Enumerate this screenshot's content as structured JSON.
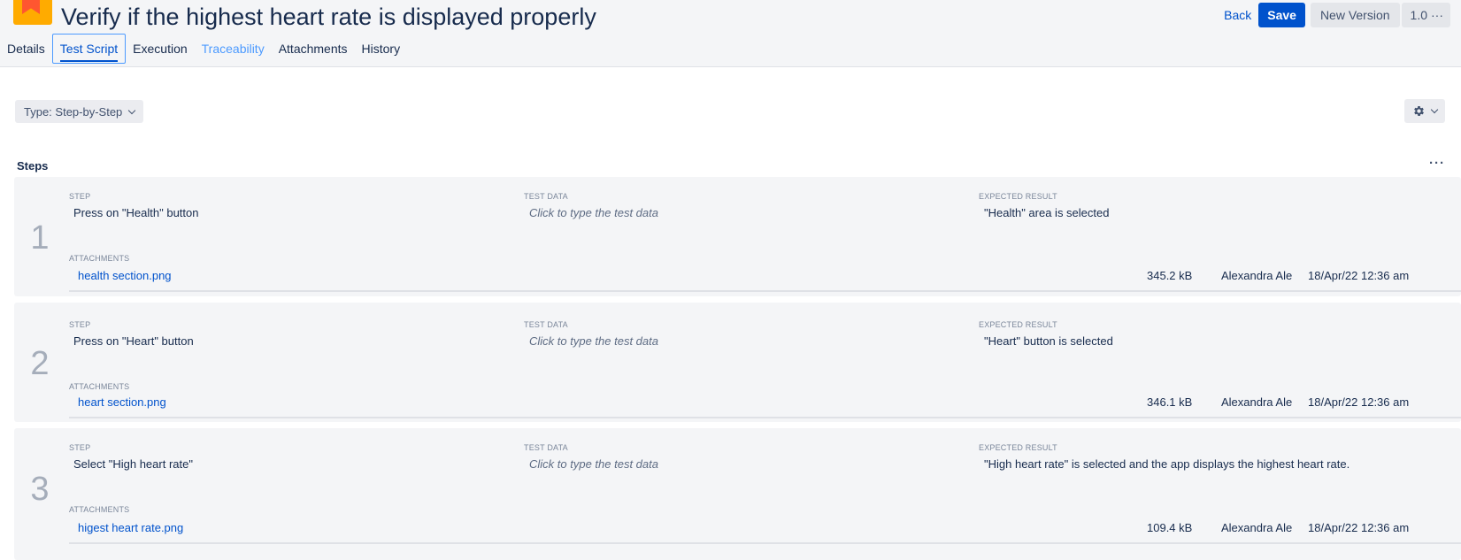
{
  "header": {
    "title": "Verify if the highest heart rate is displayed properly",
    "back_label": "Back",
    "save_label": "Save",
    "new_version_label": "New Version",
    "version": "1.0",
    "more_glyph": "···"
  },
  "tabs": [
    {
      "label": "Details"
    },
    {
      "label": "Test Script"
    },
    {
      "label": "Execution"
    },
    {
      "label": "Traceability"
    },
    {
      "label": "Attachments"
    },
    {
      "label": "History"
    }
  ],
  "toolbar": {
    "type_select": "Type: Step-by-Step",
    "settings_icon": "gear-icon"
  },
  "steps_section": {
    "label": "Steps",
    "more_glyph": "···",
    "col_step": "STEP",
    "col_test_data": "TEST DATA",
    "col_expected": "EXPECTED RESULT",
    "col_attachments": "ATTACHMENTS"
  },
  "steps": [
    {
      "number": "1",
      "step": "Press on \"Health\" button",
      "test_data": "Click to type the test data",
      "expected": "\"Health\" area is selected",
      "attachment": {
        "name": "health section.png",
        "size": "345.2 kB",
        "author": "Alexandra Ale",
        "date": "18/Apr/22 12:36 am"
      }
    },
    {
      "number": "2",
      "step": "Press on \"Heart\" button",
      "test_data": "Click to type the test data",
      "expected": "\"Heart\" button is selected",
      "attachment": {
        "name": "heart section.png",
        "size": "346.1 kB",
        "author": "Alexandra Ale",
        "date": "18/Apr/22 12:36 am"
      }
    },
    {
      "number": "3",
      "step": "Select \"High heart rate\"",
      "test_data": "Click to type the test data",
      "expected": "\"High heart rate\" is selected and the app displays the highest heart rate.",
      "attachment": {
        "name": "higest heart rate.png",
        "size": "109.4 kB",
        "author": "Alexandra Ale",
        "date": "18/Apr/22 12:36 am"
      }
    }
  ],
  "colors": {
    "primary": "#0052cc",
    "header_bg": "#f4f5f7",
    "step_bg": "#f4f5f7",
    "logo": "#ffab00",
    "logo_flag": "#ff5630"
  }
}
